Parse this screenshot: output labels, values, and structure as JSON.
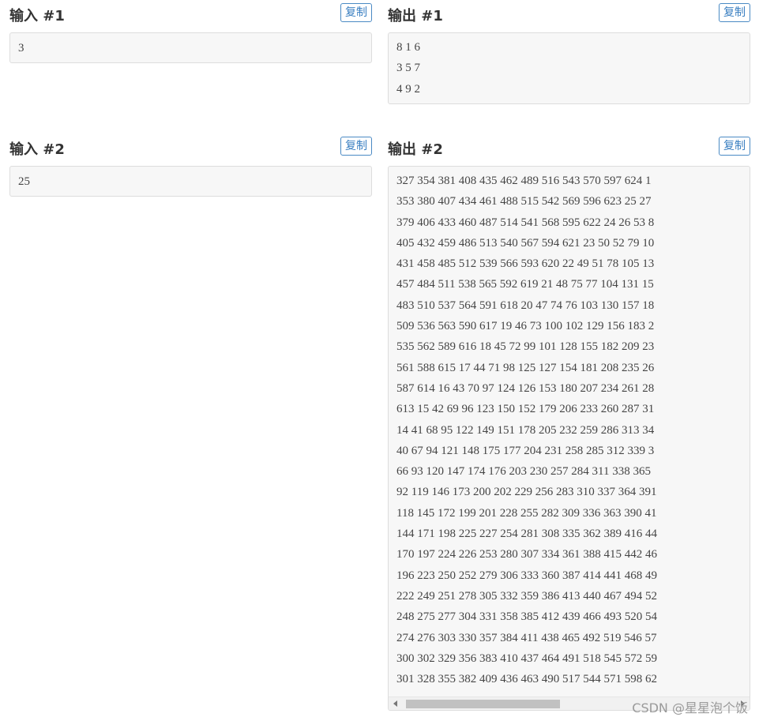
{
  "samples": [
    {
      "input_title": "输入 #1",
      "input_value": "3",
      "output_title": "输出 #1",
      "output_value": "8 1 6\n3 5 7\n4 9 2",
      "copy_label": "复制"
    },
    {
      "input_title": "输入 #2",
      "input_value": "25",
      "output_title": "输出 #2",
      "output_value": "327 354 381 408 435 462 489 516 543 570 597 624 1\n353 380 407 434 461 488 515 542 569 596 623 25 27\n379 406 433 460 487 514 541 568 595 622 24 26 53 8\n405 432 459 486 513 540 567 594 621 23 50 52 79 10\n431 458 485 512 539 566 593 620 22 49 51 78 105 13\n457 484 511 538 565 592 619 21 48 75 77 104 131 15\n483 510 537 564 591 618 20 47 74 76 103 130 157 18\n509 536 563 590 617 19 46 73 100 102 129 156 183 2\n535 562 589 616 18 45 72 99 101 128 155 182 209 23\n561 588 615 17 44 71 98 125 127 154 181 208 235 26\n587 614 16 43 70 97 124 126 153 180 207 234 261 28\n613 15 42 69 96 123 150 152 179 206 233 260 287 31\n14 41 68 95 122 149 151 178 205 232 259 286 313 34\n40 67 94 121 148 175 177 204 231 258 285 312 339 3\n66 93 120 147 174 176 203 230 257 284 311 338 365\n92 119 146 173 200 202 229 256 283 310 337 364 391\n118 145 172 199 201 228 255 282 309 336 363 390 41\n144 171 198 225 227 254 281 308 335 362 389 416 44\n170 197 224 226 253 280 307 334 361 388 415 442 46\n196 223 250 252 279 306 333 360 387 414 441 468 49\n222 249 251 278 305 332 359 386 413 440 467 494 52\n248 275 277 304 331 358 385 412 439 466 493 520 54\n274 276 303 330 357 384 411 438 465 492 519 546 57\n300 302 329 356 383 410 437 464 491 518 545 572 59\n301 328 355 382 409 436 463 490 517 544 571 598 62",
      "copy_label": "复制"
    }
  ],
  "scroll": {
    "horizontal_fraction": 0.47
  },
  "watermark": "CSDN @星星泡个饭",
  "colors": {
    "accent": "#3a7fc1",
    "code_bg": "#f7f7f7",
    "border": "#dddddd"
  }
}
